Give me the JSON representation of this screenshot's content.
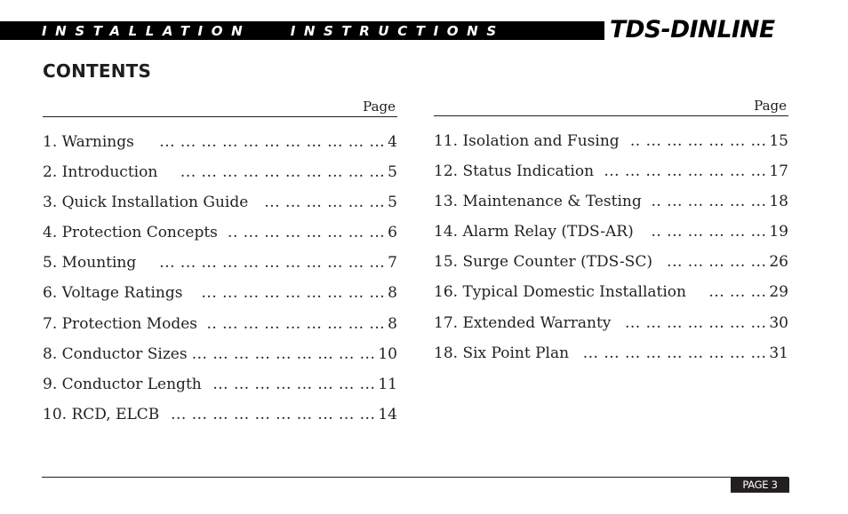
{
  "header": {
    "title": "INSTALLATION   INSTRUCTIONS",
    "logo": "TDS-DINLINE"
  },
  "contents": {
    "title": "CONTENTS",
    "page_column_label": "Page",
    "left_column": [
      {
        "label": "1. Warnings",
        "leader": "... ...  ...  ... ...  ...  ...  ...  ...  ...  ...",
        "page": "4"
      },
      {
        "label": "2. Introduction",
        "leader": "... ...  ...  ... ...  ...  ...  ...  ...  ...",
        "page": "5"
      },
      {
        "label": "3. Quick Installation Guide",
        "leader": "... ...  ... ...  ...  ...",
        "page": "5"
      },
      {
        "label": "4. Protection Concepts",
        "leader": ".. ... ...  ...  ...  ...  ...  ...",
        "page": "6"
      },
      {
        "label": "5. Mounting",
        "leader": "... ...  ...  ...  ... ...  ...  ...  ...  ...  ...",
        "page": "7"
      },
      {
        "label": "6. Voltage Ratings",
        "leader": "... ...  ...  ...  ... ...  ...  ...  ...",
        "page": "8"
      },
      {
        "label": "7. Protection Modes",
        "leader": ".. ... ... ...  ...  ...  ...  ...  ...",
        "page": "8"
      },
      {
        "label": "8. Conductor Sizes",
        "leader": "... ... ... ...  ...  ...  ...  ...  ...",
        "page": "10"
      },
      {
        "label": "9. Conductor Length",
        "leader": "... ... ...  ...  ...  ...  ...  ...",
        "page": "11"
      },
      {
        "label": "10. RCD, ELCB",
        "leader": "... ... ... ... ...  ...  ...  ...  ...  ...",
        "page": "14"
      }
    ],
    "right_column": [
      {
        "label": "11. Isolation and Fusing",
        "leader": ".. ...  ...  ...  ...  ...  ...",
        "page": "15"
      },
      {
        "label": "12. Status Indication",
        "leader": "... ... ...  ...  ...  ...  ...  ...",
        "page": "17"
      },
      {
        "label": "13. Maintenance & Testing",
        "leader": ".. ...  ...  ...  ...  ...",
        "page": "18"
      },
      {
        "label": "14. Alarm Relay (TDS-AR)",
        "leader": ".. ...  ...  ...  ...  ...",
        "page": "19"
      },
      {
        "label": "15. Surge Counter (TDS-SC)",
        "leader": "...  ...  ...  ...  ...",
        "page": "26"
      },
      {
        "label": "16. Typical Domestic Installation",
        "leader": "...  ...  ...",
        "page": "29"
      },
      {
        "label": "17. Extended Warranty",
        "leader": "... ...  ...  ...  ...  ...  ...",
        "page": "30"
      },
      {
        "label": "18. Six Point Plan",
        "leader": "... ... ... ...  ...  ...  ...  ...  ...",
        "page": "31"
      }
    ]
  },
  "footer": {
    "page_label": "PAGE 3"
  }
}
